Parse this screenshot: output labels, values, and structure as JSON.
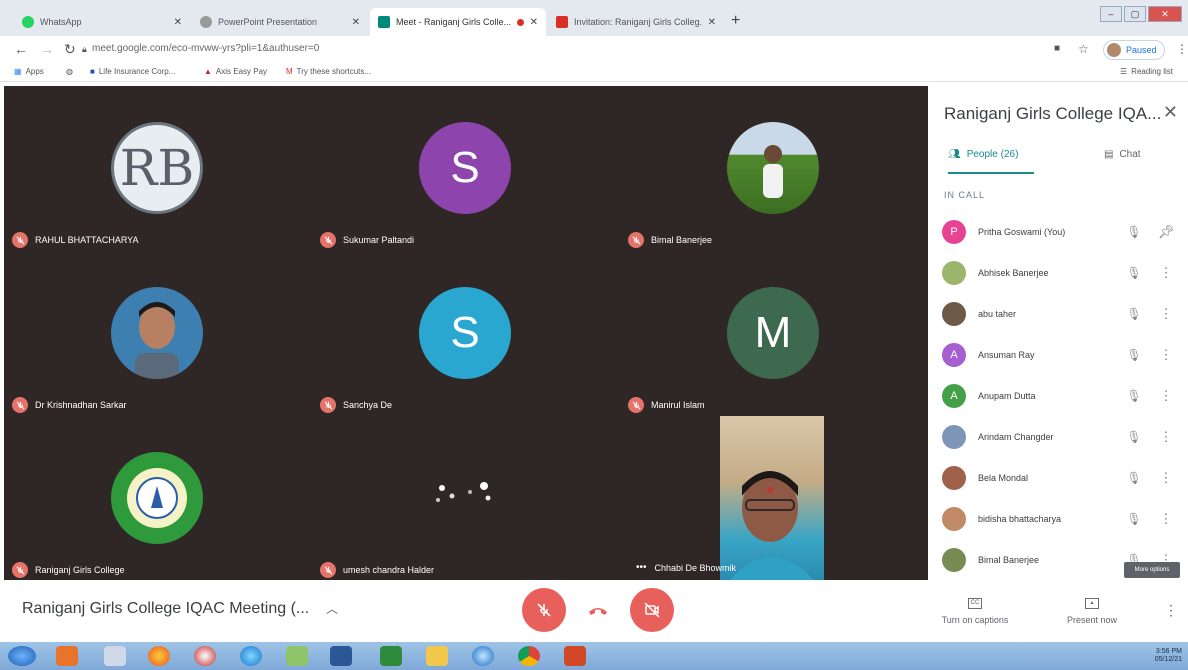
{
  "browser": {
    "tabs": [
      {
        "label": "WhatsApp",
        "active": false,
        "color": "#25d366"
      },
      {
        "label": "PowerPoint Presentation",
        "active": false,
        "color": "#999999"
      },
      {
        "label": "Meet - Raniganj Girls Colle...",
        "active": true,
        "color": "#00897b"
      },
      {
        "label": "Invitation: Raniganj Girls Colleg...",
        "active": false,
        "color": "#d93025"
      }
    ],
    "new_tab": "+",
    "url": "meet.google.com/eco-mvww-yrs?pli=1&authuser=0",
    "profile_label": "Paused",
    "reading_list": "Reading list",
    "bookmarks": [
      {
        "label": "Apps",
        "icon": "apps-grid-icon"
      },
      {
        "label": "",
        "icon": "globe-icon"
      },
      {
        "label": "Life Insurance Corp...",
        "icon": "lic-icon"
      },
      {
        "label": "Axis Easy Pay",
        "icon": "axis-icon"
      },
      {
        "label": "Try these shortcuts...",
        "icon": "gmail-icon"
      }
    ]
  },
  "meet": {
    "participants_grid": [
      {
        "name": "RAHUL BHATTACHARYA",
        "avatar_type": "logo",
        "avatar_text": "RB",
        "bg": "#e8edf2"
      },
      {
        "name": "Sukumar Paltandi",
        "avatar_type": "letter",
        "avatar_text": "S",
        "bg": "#8e44ad"
      },
      {
        "name": "Bimal Banerjee",
        "avatar_type": "photo",
        "avatar_text": "",
        "bg": "#6b8f3a"
      },
      {
        "name": "Dr Krishnadhan Sarkar",
        "avatar_type": "photo",
        "avatar_text": "",
        "bg": "#3d7fb0"
      },
      {
        "name": "Sanchya De",
        "avatar_type": "letter",
        "avatar_text": "S",
        "bg": "#2aa7d0"
      },
      {
        "name": "Manirul Islam",
        "avatar_type": "letter",
        "avatar_text": "M",
        "bg": "#3d6a4f"
      },
      {
        "name": "Raniganj Girls College",
        "avatar_type": "logo",
        "avatar_text": "",
        "bg": "#2e9a3b"
      },
      {
        "name": "umesh chandra Halder",
        "avatar_type": "dots",
        "avatar_text": "",
        "bg": "#2f2726"
      },
      {
        "name": "Chhabi De Bhowmik",
        "avatar_type": "video",
        "avatar_text": "",
        "bg": "#8a6a58"
      }
    ],
    "panel": {
      "title": "Raniganj Girls College IQA...",
      "tab_people": "People (26)",
      "tab_chat": "Chat",
      "section": "IN CALL",
      "people": [
        {
          "name": "Pritha Goswami (You)",
          "avatar_text": "P",
          "color": "#e84393",
          "action": "pin"
        },
        {
          "name": "Abhisek Banerjee",
          "avatar_text": "",
          "color": "#9bb56a",
          "action": "more"
        },
        {
          "name": "abu taher",
          "avatar_text": "",
          "color": "#6d5a48",
          "action": "more"
        },
        {
          "name": "Ansuman Ray",
          "avatar_text": "A",
          "color": "#a55fd1",
          "action": "more"
        },
        {
          "name": "Anupam Dutta",
          "avatar_text": "A",
          "color": "#43a047",
          "action": "more"
        },
        {
          "name": "Arindam Changder",
          "avatar_text": "",
          "color": "#7d96b8",
          "action": "more"
        },
        {
          "name": "Bela Mondal",
          "avatar_text": "",
          "color": "#a0614a",
          "action": "more"
        },
        {
          "name": "bidisha bhattacharya",
          "avatar_text": "",
          "color": "#c08a66",
          "action": "more"
        },
        {
          "name": "Bimal Banerjee",
          "avatar_text": "",
          "color": "#7a8a54",
          "action": "more"
        }
      ],
      "tooltip": "More options"
    },
    "bottom": {
      "meeting_title": "Raniganj Girls College IQAC Meeting (...",
      "captions_label": "Turn on captions",
      "present_label": "Present now",
      "captions_icon_text": "CC"
    }
  },
  "taskbar": {
    "clock": "3:56 PM",
    "date": "05/12/21"
  },
  "colors": {
    "stage_bg": "#2f2726",
    "mute_red": "#e5736a",
    "control_red": "#e8605c",
    "accent_teal": "#1a8a8a"
  }
}
